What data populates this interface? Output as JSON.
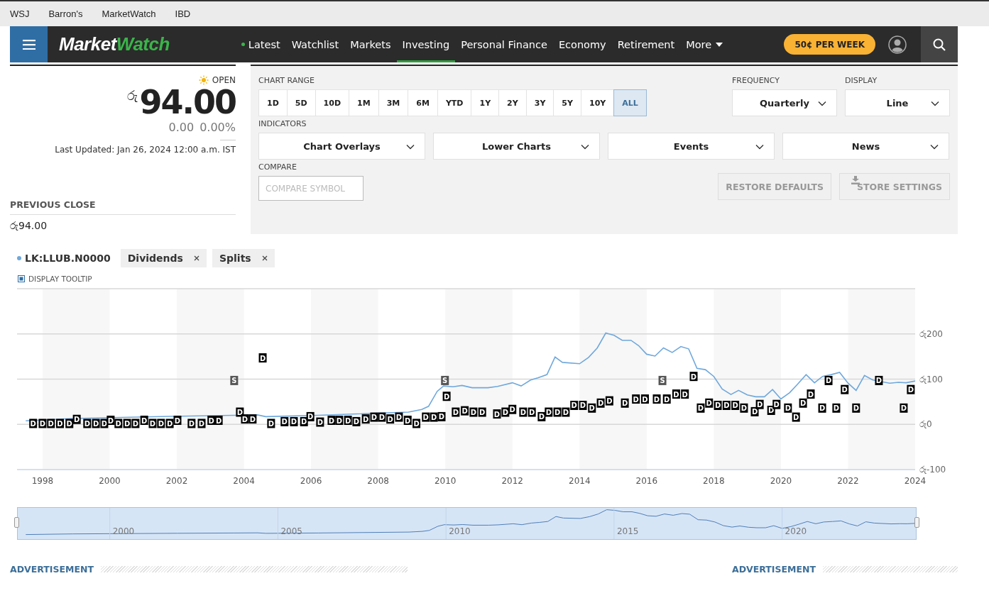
{
  "top_links": [
    "WSJ",
    "Barron's",
    "MarketWatch",
    "IBD"
  ],
  "logo": [
    "Market",
    "Watch"
  ],
  "nav": [
    {
      "label": "Latest",
      "live": true,
      "selected": false
    },
    {
      "label": "Watchlist",
      "live": false,
      "selected": false
    },
    {
      "label": "Markets",
      "live": false,
      "selected": false
    },
    {
      "label": "Investing",
      "live": false,
      "selected": true
    },
    {
      "label": "Personal Finance",
      "live": false,
      "selected": false
    },
    {
      "label": "Economy",
      "live": false,
      "selected": false
    },
    {
      "label": "Retirement",
      "live": false,
      "selected": false
    }
  ],
  "more": "More",
  "subscribe": "50¢ PER WEEK",
  "quote": {
    "status": "OPEN",
    "currency": "රු",
    "price": "94.00",
    "change": "0.00",
    "change_percent": "0.00%",
    "last_updated": "Last Updated: Jan 26, 2024 12:00 a.m. IST",
    "previous_close_label": "PREVIOUS CLOSE",
    "previous_close": "රු94.00"
  },
  "controls": {
    "chart_range_label": "CHART RANGE",
    "ranges": [
      {
        "label": "1D",
        "selected": false
      },
      {
        "label": "5D",
        "selected": false
      },
      {
        "label": "10D",
        "selected": false
      },
      {
        "label": "1M",
        "selected": false
      },
      {
        "label": "3M",
        "selected": false
      },
      {
        "label": "6M",
        "selected": false
      },
      {
        "label": "YTD",
        "selected": false
      },
      {
        "label": "1Y",
        "selected": false
      },
      {
        "label": "2Y",
        "selected": false
      },
      {
        "label": "3Y",
        "selected": false
      },
      {
        "label": "5Y",
        "selected": false
      },
      {
        "label": "10Y",
        "selected": false
      },
      {
        "label": "ALL",
        "selected": true
      }
    ],
    "frequency_label": "FREQUENCY",
    "frequency": "Quarterly",
    "display_label": "DISPLAY",
    "display": "Line",
    "indicators_label": "INDICATORS",
    "indicators": [
      "Chart Overlays",
      "Lower Charts",
      "Events",
      "News"
    ],
    "compare_label": "COMPARE",
    "compare_placeholder": "COMPARE SYMBOL",
    "buttons": [
      {
        "label": "RESTORE DEFAULTS",
        "kind": "plain",
        "disabled": true
      },
      {
        "label": "STORE SETTINGS",
        "kind": "download",
        "disabled": true
      }
    ]
  },
  "legend": {
    "chips": [
      "Dividends",
      "Splits"
    ]
  },
  "tooltip_toggle": {
    "label": "DISPLAY TOOLTIP",
    "checked": true
  },
  "chart": {
    "chart_data": {
      "type": "line",
      "grid": true,
      "xlim": [
        1997.24,
        2024
      ],
      "ylim": [
        -100,
        300
      ],
      "xticks": [
        1998,
        2000,
        2002,
        2004,
        2006,
        2008,
        2010,
        2012,
        2014,
        2016,
        2018,
        2020,
        2022,
        2024
      ],
      "yticks": [
        {
          "value": -100,
          "label": "රු-100"
        },
        {
          "value": 0,
          "label": "රු0"
        },
        {
          "value": 100,
          "label": "රු100"
        },
        {
          "value": 200,
          "label": "රු200"
        }
      ],
      "x": [
        1997.5,
        1998.9,
        2002,
        2003.7,
        2004.4,
        2004.65,
        2006.2,
        2008.9,
        2009.3,
        2009.5,
        2009.76,
        2009.95,
        2010.23,
        2010.5,
        2010.8,
        2011.27,
        2011.56,
        2012,
        2012.26,
        2012.54,
        2012.77,
        2013.03,
        2013.27,
        2013.49,
        2014,
        2014.27,
        2014.53,
        2014.78,
        2015.03,
        2015.27,
        2015.53,
        2015.76,
        2016,
        2016.25,
        2016.5,
        2016.76,
        2017.02,
        2017.25,
        2017.5,
        2017.75,
        2018,
        2018.25,
        2018.51,
        2018.74,
        2019,
        2019.25,
        2019.51,
        2019.75,
        2020,
        2020.26,
        2020.5,
        2020.75,
        2021,
        2021.24,
        2021.5,
        2021.75,
        2022,
        2022.24,
        2022.49,
        2022.74,
        2023.24,
        2023.5,
        2023.73,
        2024
      ],
      "series": [
        {
          "name": "LK:LLUB.N0000",
          "color": "#6fa8dc",
          "values": [
            8,
            13,
            18,
            20,
            21,
            17,
            20,
            27,
            33,
            40,
            73,
            85,
            83,
            86,
            81,
            81,
            84,
            92,
            85,
            98,
            103,
            110,
            149,
            137,
            134,
            148,
            169,
            202,
            197,
            186,
            186,
            174,
            155,
            151,
            169,
            159,
            172,
            167,
            124,
            121,
            106,
            78,
            66,
            75,
            65,
            61,
            61,
            77,
            56,
            70,
            89,
            110,
            92,
            106,
            110,
            115,
            91,
            75,
            108,
            98,
            91,
            93,
            92,
            96
          ]
        }
      ],
      "annotations": [
        {
          "x": 1997.72,
          "y": 2,
          "text": "D"
        },
        {
          "x": 1998.0,
          "y": 2,
          "text": "D"
        },
        {
          "x": 1998.25,
          "y": 2,
          "text": "D"
        },
        {
          "x": 1998.52,
          "y": 2,
          "text": "D"
        },
        {
          "x": 1998.8,
          "y": 2,
          "text": "D"
        },
        {
          "x": 1999.02,
          "y": 11,
          "text": "D"
        },
        {
          "x": 1999.33,
          "y": 2,
          "text": "D"
        },
        {
          "x": 1999.59,
          "y": 2,
          "text": "D"
        },
        {
          "x": 1999.84,
          "y": 2,
          "text": "D"
        },
        {
          "x": 2000.03,
          "y": 9,
          "text": "D"
        },
        {
          "x": 2000.26,
          "y": 2,
          "text": "D"
        },
        {
          "x": 2000.52,
          "y": 2,
          "text": "D"
        },
        {
          "x": 2000.77,
          "y": 2,
          "text": "D"
        },
        {
          "x": 2001.03,
          "y": 9,
          "text": "D"
        },
        {
          "x": 2001.28,
          "y": 2,
          "text": "D"
        },
        {
          "x": 2001.53,
          "y": 2,
          "text": "D"
        },
        {
          "x": 2001.79,
          "y": 2,
          "text": "D"
        },
        {
          "x": 2002.02,
          "y": 9,
          "text": "D"
        },
        {
          "x": 2002.44,
          "y": 2,
          "text": "D"
        },
        {
          "x": 2002.74,
          "y": 2,
          "text": "D"
        },
        {
          "x": 2003.03,
          "y": 9,
          "text": "D"
        },
        {
          "x": 2003.25,
          "y": 9,
          "text": "D"
        },
        {
          "x": 2003.71,
          "y": 97,
          "text": "S"
        },
        {
          "x": 2003.88,
          "y": 27,
          "text": "D"
        },
        {
          "x": 2004.03,
          "y": 12,
          "text": "D"
        },
        {
          "x": 2004.26,
          "y": 12,
          "text": "D"
        },
        {
          "x": 2004.56,
          "y": 147,
          "text": "D"
        },
        {
          "x": 2004.81,
          "y": 2,
          "text": "D"
        },
        {
          "x": 2005.21,
          "y": 6,
          "text": "D"
        },
        {
          "x": 2005.49,
          "y": 6,
          "text": "D"
        },
        {
          "x": 2005.79,
          "y": 6,
          "text": "D"
        },
        {
          "x": 2005.98,
          "y": 17,
          "text": "D"
        },
        {
          "x": 2006.27,
          "y": 5,
          "text": "D"
        },
        {
          "x": 2006.61,
          "y": 9,
          "text": "D"
        },
        {
          "x": 2006.84,
          "y": 9,
          "text": "D"
        },
        {
          "x": 2007.1,
          "y": 9,
          "text": "D"
        },
        {
          "x": 2007.35,
          "y": 6,
          "text": "D"
        },
        {
          "x": 2007.63,
          "y": 12,
          "text": "D"
        },
        {
          "x": 2007.88,
          "y": 16,
          "text": "D"
        },
        {
          "x": 2008.11,
          "y": 16,
          "text": "D"
        },
        {
          "x": 2008.36,
          "y": 12,
          "text": "D"
        },
        {
          "x": 2008.62,
          "y": 16,
          "text": "D"
        },
        {
          "x": 2008.88,
          "y": 9,
          "text": "D"
        },
        {
          "x": 2009.14,
          "y": 2,
          "text": "D"
        },
        {
          "x": 2009.42,
          "y": 16,
          "text": "D"
        },
        {
          "x": 2009.66,
          "y": 16,
          "text": "D"
        },
        {
          "x": 2009.89,
          "y": 17,
          "text": "D"
        },
        {
          "x": 2009.99,
          "y": 97,
          "text": "S"
        },
        {
          "x": 2010.04,
          "y": 62,
          "text": "D"
        },
        {
          "x": 2010.31,
          "y": 27,
          "text": "D"
        },
        {
          "x": 2010.58,
          "y": 30,
          "text": "D"
        },
        {
          "x": 2010.84,
          "y": 27,
          "text": "D"
        },
        {
          "x": 2011.1,
          "y": 27,
          "text": "D"
        },
        {
          "x": 2011.54,
          "y": 23,
          "text": "D"
        },
        {
          "x": 2011.79,
          "y": 27,
          "text": "D"
        },
        {
          "x": 2012.0,
          "y": 33,
          "text": "D"
        },
        {
          "x": 2012.32,
          "y": 27,
          "text": "D"
        },
        {
          "x": 2012.58,
          "y": 27,
          "text": "D"
        },
        {
          "x": 2012.87,
          "y": 17,
          "text": "D"
        },
        {
          "x": 2013.08,
          "y": 27,
          "text": "D"
        },
        {
          "x": 2013.34,
          "y": 27,
          "text": "D"
        },
        {
          "x": 2013.59,
          "y": 27,
          "text": "D"
        },
        {
          "x": 2013.84,
          "y": 42,
          "text": "D"
        },
        {
          "x": 2014.1,
          "y": 42,
          "text": "D"
        },
        {
          "x": 2014.37,
          "y": 36,
          "text": "D"
        },
        {
          "x": 2014.63,
          "y": 47,
          "text": "D"
        },
        {
          "x": 2014.89,
          "y": 52,
          "text": "D"
        },
        {
          "x": 2015.35,
          "y": 47,
          "text": "D"
        },
        {
          "x": 2015.68,
          "y": 56,
          "text": "D"
        },
        {
          "x": 2015.95,
          "y": 56,
          "text": "D"
        },
        {
          "x": 2016.3,
          "y": 56,
          "text": "D"
        },
        {
          "x": 2016.47,
          "y": 97,
          "text": "S"
        },
        {
          "x": 2016.6,
          "y": 56,
          "text": "D"
        },
        {
          "x": 2016.88,
          "y": 67,
          "text": "D"
        },
        {
          "x": 2017.14,
          "y": 67,
          "text": "D"
        },
        {
          "x": 2017.4,
          "y": 106,
          "text": "D"
        },
        {
          "x": 2017.61,
          "y": 36,
          "text": "D"
        },
        {
          "x": 2017.86,
          "y": 47,
          "text": "D"
        },
        {
          "x": 2018.12,
          "y": 42,
          "text": "D"
        },
        {
          "x": 2018.38,
          "y": 42,
          "text": "D"
        },
        {
          "x": 2018.64,
          "y": 42,
          "text": "D"
        },
        {
          "x": 2018.9,
          "y": 36,
          "text": "D"
        },
        {
          "x": 2019.22,
          "y": 28,
          "text": "D"
        },
        {
          "x": 2019.37,
          "y": 44,
          "text": "D"
        },
        {
          "x": 2019.71,
          "y": 31,
          "text": "D"
        },
        {
          "x": 2019.87,
          "y": 44,
          "text": "D"
        },
        {
          "x": 2020.21,
          "y": 36,
          "text": "D"
        },
        {
          "x": 2020.45,
          "y": 16,
          "text": "D"
        },
        {
          "x": 2020.66,
          "y": 47,
          "text": "D"
        },
        {
          "x": 2020.89,
          "y": 67,
          "text": "D"
        },
        {
          "x": 2021.23,
          "y": 36,
          "text": "D"
        },
        {
          "x": 2021.42,
          "y": 97,
          "text": "D"
        },
        {
          "x": 2021.65,
          "y": 36,
          "text": "D"
        },
        {
          "x": 2021.9,
          "y": 77,
          "text": "D"
        },
        {
          "x": 2022.24,
          "y": 36,
          "text": "D"
        },
        {
          "x": 2022.92,
          "y": 97,
          "text": "D"
        },
        {
          "x": 2023.66,
          "y": 36,
          "text": "D"
        },
        {
          "x": 2023.87,
          "y": 77,
          "text": "D"
        }
      ]
    }
  },
  "navigator": {
    "labels": [
      "2000",
      "2005",
      "2010",
      "2015",
      "2020"
    ]
  },
  "ads": [
    "ADVERTISEMENT",
    "ADVERTISEMENT"
  ]
}
